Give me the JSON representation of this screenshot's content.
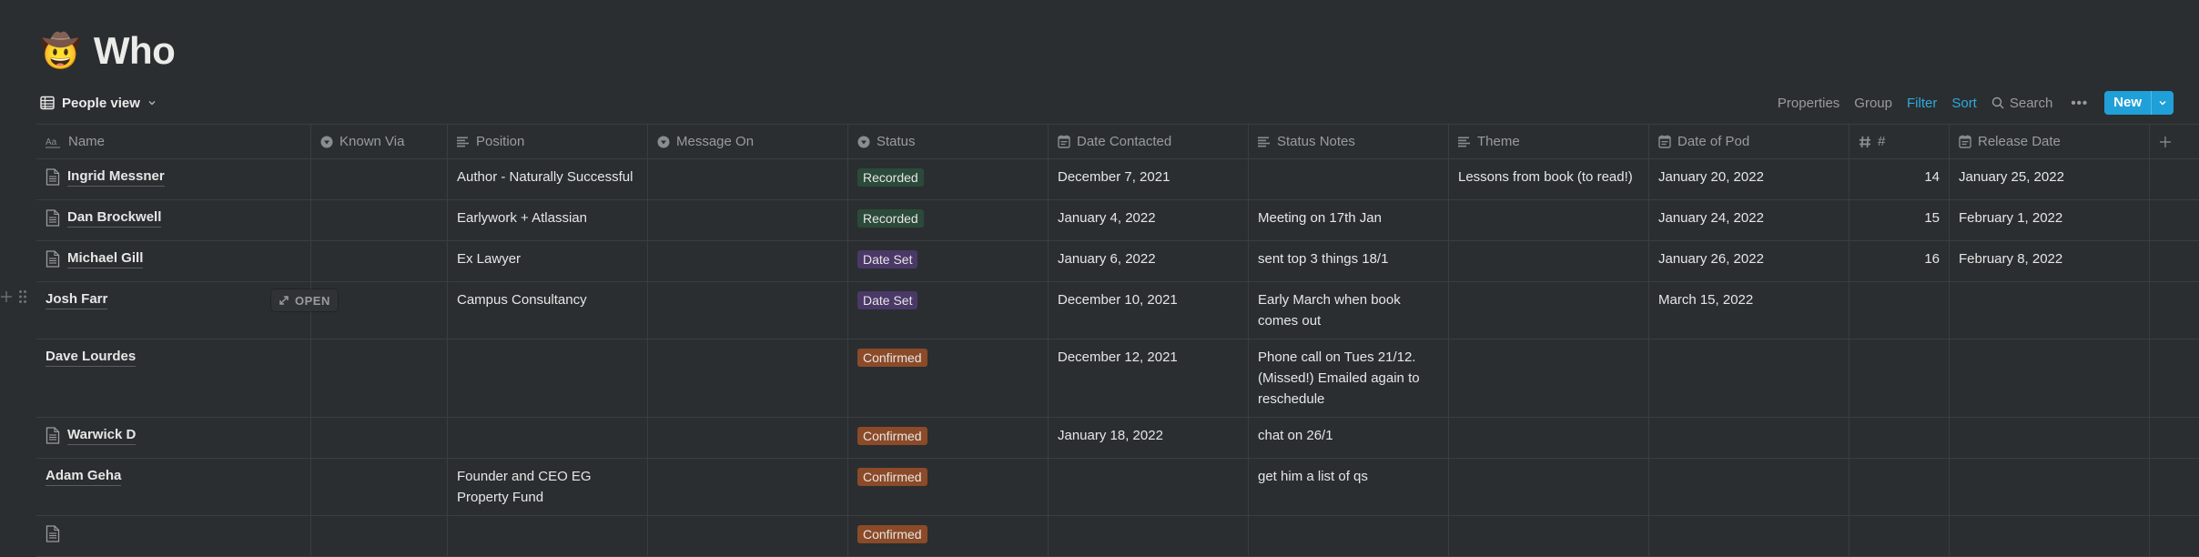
{
  "page": {
    "emoji": "🤠",
    "title": "Who"
  },
  "view": {
    "label": "People view",
    "icon": "table-icon"
  },
  "toolbar": {
    "properties": "Properties",
    "group": "Group",
    "filter": "Filter",
    "sort": "Sort",
    "search": "Search",
    "more": "•••",
    "new": "New",
    "accent": "#1fa0d8"
  },
  "columns": [
    {
      "key": "name",
      "label": "Name",
      "icon": "text-aa-icon"
    },
    {
      "key": "known_via",
      "label": "Known Via",
      "icon": "select-icon"
    },
    {
      "key": "position",
      "label": "Position",
      "icon": "text-lines-icon"
    },
    {
      "key": "message_on",
      "label": "Message On",
      "icon": "select-icon"
    },
    {
      "key": "status",
      "label": "Status",
      "icon": "select-icon"
    },
    {
      "key": "date_contacted",
      "label": "Date Contacted",
      "icon": "calendar-icon"
    },
    {
      "key": "status_notes",
      "label": "Status Notes",
      "icon": "text-lines-icon"
    },
    {
      "key": "theme",
      "label": "Theme",
      "icon": "text-lines-icon"
    },
    {
      "key": "date_of_pod",
      "label": "Date of Pod",
      "icon": "calendar-icon"
    },
    {
      "key": "num",
      "label": "#",
      "icon": "number-icon"
    },
    {
      "key": "release_date",
      "label": "Release Date",
      "icon": "calendar-icon"
    }
  ],
  "status_colors": {
    "Recorded": "#2b4a3a",
    "Date Set": "#4a3867",
    "Confirmed": "#8b4a28"
  },
  "hover_row": {
    "open_label": "OPEN"
  },
  "rows": [
    {
      "name": "Ingrid Messner",
      "has_doc": true,
      "known_via": "",
      "position": "Author - Naturally Successful",
      "message_on": "",
      "status": "Recorded",
      "date_contacted": "December 7, 2021",
      "status_notes": "",
      "theme": "Lessons from book (to read!)",
      "date_of_pod": "January 20, 2022",
      "num": "14",
      "release_date": "January 25, 2022"
    },
    {
      "name": "Dan Brockwell",
      "has_doc": true,
      "known_via": "",
      "position": "Earlywork + Atlassian",
      "message_on": "",
      "status": "Recorded",
      "date_contacted": "January 4, 2022",
      "status_notes": "Meeting on 17th Jan",
      "theme": "",
      "date_of_pod": "January 24, 2022",
      "num": "15",
      "release_date": "February 1, 2022"
    },
    {
      "name": "Michael Gill",
      "has_doc": true,
      "known_via": "",
      "position": "Ex Lawyer",
      "message_on": "",
      "status": "Date Set",
      "date_contacted": "January 6, 2022",
      "status_notes": "sent top 3 things 18/1",
      "theme": "",
      "date_of_pod": "January 26, 2022",
      "num": "16",
      "release_date": "February 8, 2022"
    },
    {
      "name": "Josh Farr",
      "has_doc": false,
      "hover": true,
      "known_via": "",
      "position": "Campus Consultancy",
      "message_on": "",
      "status": "Date Set",
      "date_contacted": "December 10, 2021",
      "status_notes": "Early March when book comes out",
      "theme": "",
      "date_of_pod": "March 15, 2022",
      "num": "",
      "release_date": ""
    },
    {
      "name": "Dave Lourdes",
      "has_doc": false,
      "known_via": "",
      "position": "",
      "message_on": "",
      "status": "Confirmed",
      "date_contacted": "December 12, 2021",
      "status_notes": "Phone call on Tues 21/12. (Missed!) Emailed again to reschedule",
      "theme": "",
      "date_of_pod": "",
      "num": "",
      "release_date": ""
    },
    {
      "name": "Warwick D",
      "has_doc": true,
      "known_via": "",
      "position": "",
      "message_on": "",
      "status": "Confirmed",
      "date_contacted": "January 18, 2022",
      "status_notes": "chat on 26/1",
      "theme": "",
      "date_of_pod": "",
      "num": "",
      "release_date": ""
    },
    {
      "name": "Adam Geha",
      "has_doc": false,
      "known_via": "",
      "position": "Founder and CEO EG Property Fund",
      "message_on": "",
      "status": "Confirmed",
      "date_contacted": "",
      "status_notes": "get him a list of qs",
      "theme": "",
      "date_of_pod": "",
      "num": "",
      "release_date": ""
    },
    {
      "name": "",
      "has_doc": true,
      "known_via": "",
      "position": "",
      "message_on": "",
      "status": "Confirmed",
      "date_contacted": "",
      "status_notes": "",
      "theme": "",
      "date_of_pod": "",
      "num": "",
      "release_date": ""
    }
  ]
}
